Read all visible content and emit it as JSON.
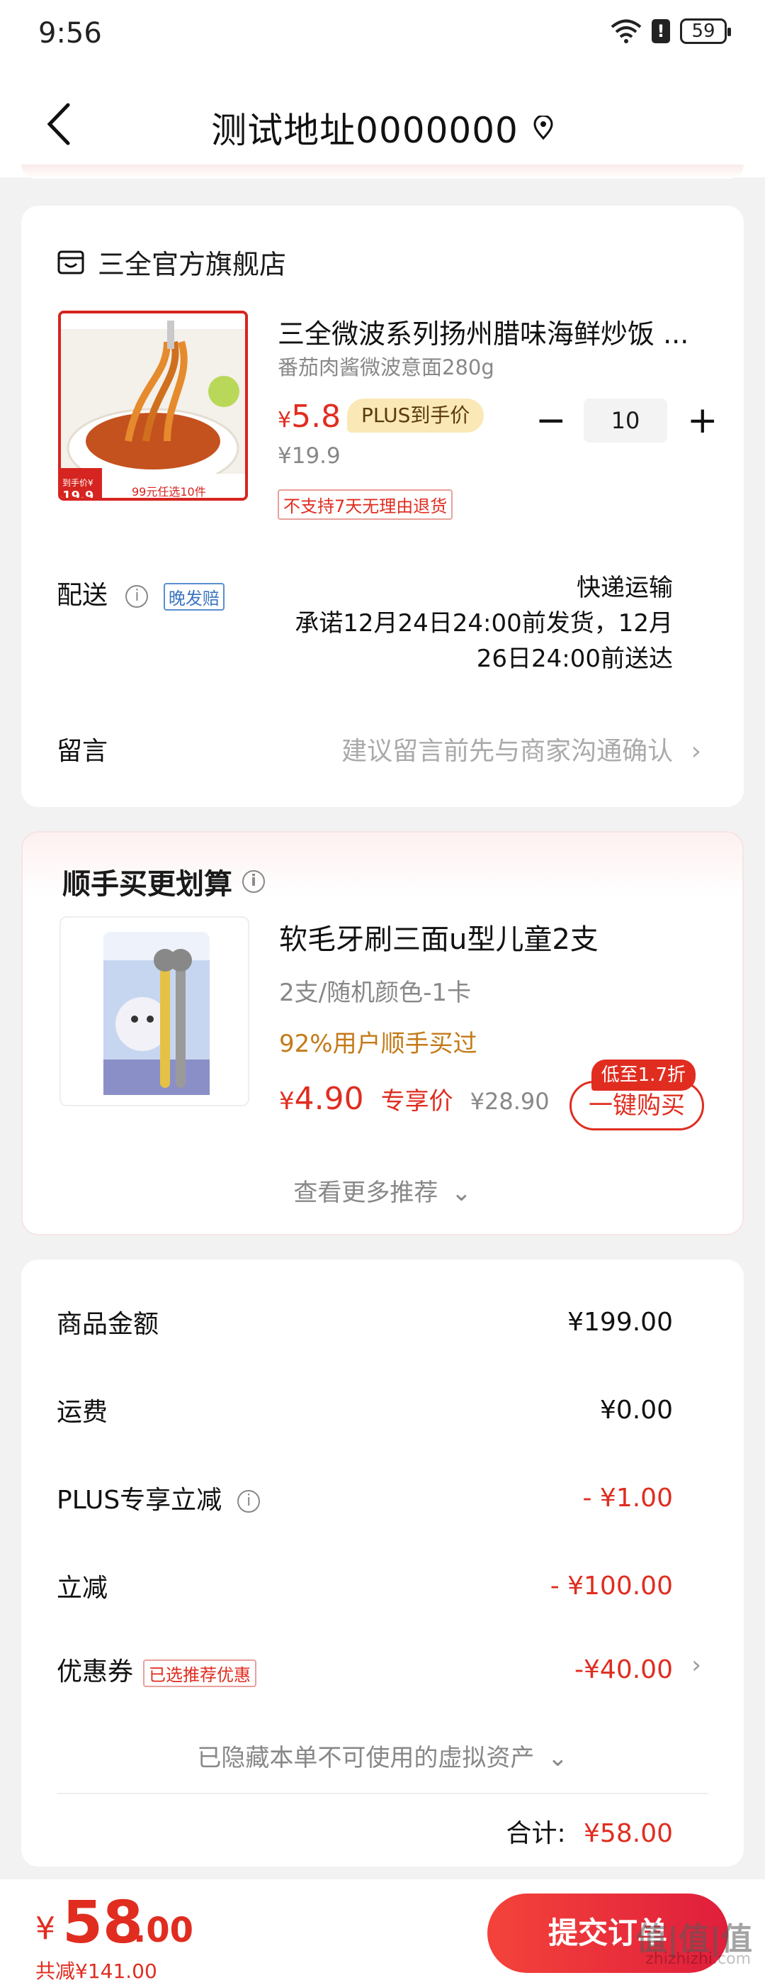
{
  "status_bar": {
    "time": "9:56",
    "battery": "59"
  },
  "header": {
    "title": "测试地址0000000"
  },
  "shop": {
    "name": "三全官方旗舰店",
    "product": {
      "name": "三全微波系列扬州腊味海鲜炒饭 ...",
      "spec": "番茄肉酱微波意面280g",
      "price_symbol": "¥",
      "price": "5.8",
      "plus_tag": "PLUS到手价",
      "original_price": "¥19.9",
      "return_policy": "不支持7天无理由退货",
      "quantity": "10",
      "image_caption_1": "到手价¥",
      "image_price": "19.9",
      "image_caption_2": "99元任选10件"
    },
    "delivery": {
      "label": "配送",
      "tag": "晚发赔",
      "method": "快递运输",
      "promise_line1": "承诺12月24日24:00前发货，12月",
      "promise_line2": "26日24:00前送达"
    },
    "remark": {
      "label": "留言",
      "placeholder": "建议留言前先与商家沟通确认"
    }
  },
  "recommend": {
    "title": "顺手买更划算",
    "product": {
      "name": "软毛牙刷三面u型儿童2支",
      "spec": "2支/随机颜色-1卡",
      "bought": "92%用户顺手买过",
      "price_symbol": "¥",
      "price": "4.90",
      "price_tag": "专享价",
      "original_price": "¥28.90",
      "discount_badge": "低至1.7折",
      "buy_button": "一键购买"
    },
    "more": "查看更多推荐"
  },
  "summary": {
    "goods_label": "商品金额",
    "goods_value": "¥199.00",
    "shipping_label": "运费",
    "shipping_value": "¥0.00",
    "plus_label": "PLUS专享立减",
    "plus_value": "- ¥1.00",
    "reduce_label": "立减",
    "reduce_value": "- ¥100.00",
    "coupon_label": "优惠券",
    "coupon_tag": "已选推荐优惠",
    "coupon_value": "-¥40.00",
    "hidden_assets": "已隐藏本单不可使用的虚拟资产",
    "total_label": "合计:",
    "total_value": "¥58.00"
  },
  "bottom": {
    "yen": "¥",
    "total_int": "58",
    "total_dec": ".00",
    "saved": "共减¥141.00",
    "submit": "提交订单",
    "watermark": "zhizhizhi.com",
    "watermark_logo": "值|值|值"
  },
  "colors": {
    "accent": "#e02d20",
    "plus_bg": "#fae8b6",
    "page_bg": "#f2f2f2"
  }
}
